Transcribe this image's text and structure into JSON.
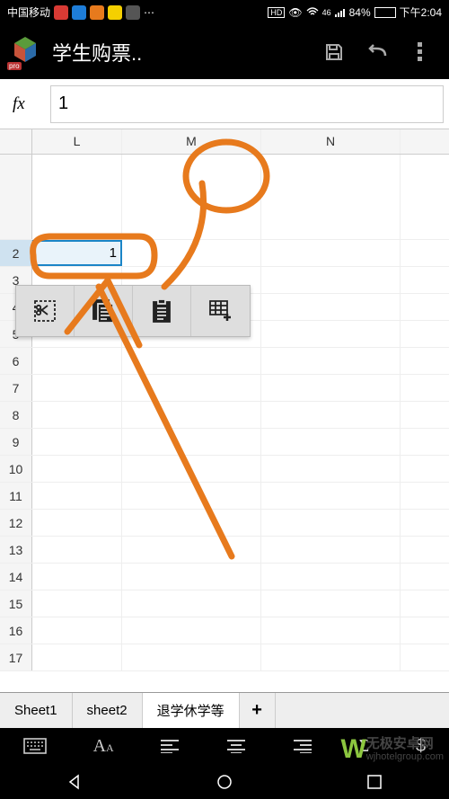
{
  "status": {
    "carrier": "中国移动",
    "net_badge": "HD",
    "signal": "46",
    "battery_pct": "84%",
    "time": "下午2:04"
  },
  "app": {
    "title": "学生购票..",
    "logo_badge": "pro"
  },
  "formula": {
    "label": "fx",
    "value": "1"
  },
  "grid": {
    "cols": [
      "L",
      "M",
      "N"
    ],
    "rows": [
      "2",
      "3",
      "4",
      "5",
      "6",
      "7",
      "8",
      "9",
      "10",
      "11",
      "12",
      "13",
      "14",
      "15",
      "16",
      "17"
    ],
    "selected": {
      "row": "2",
      "value": "1"
    }
  },
  "popup": {
    "items": [
      {
        "name": "cut"
      },
      {
        "name": "copy"
      },
      {
        "name": "paste"
      },
      {
        "name": "insert-cells"
      }
    ]
  },
  "tabs": {
    "items": [
      "Sheet1",
      "sheet2",
      "退学休学等"
    ],
    "active_index": 2,
    "add": "+"
  },
  "toolbar": {
    "sigma": "Σ",
    "dollar": "$"
  },
  "watermark": {
    "brand": "无极安卓网",
    "url": "wjhotelgroup.com"
  }
}
